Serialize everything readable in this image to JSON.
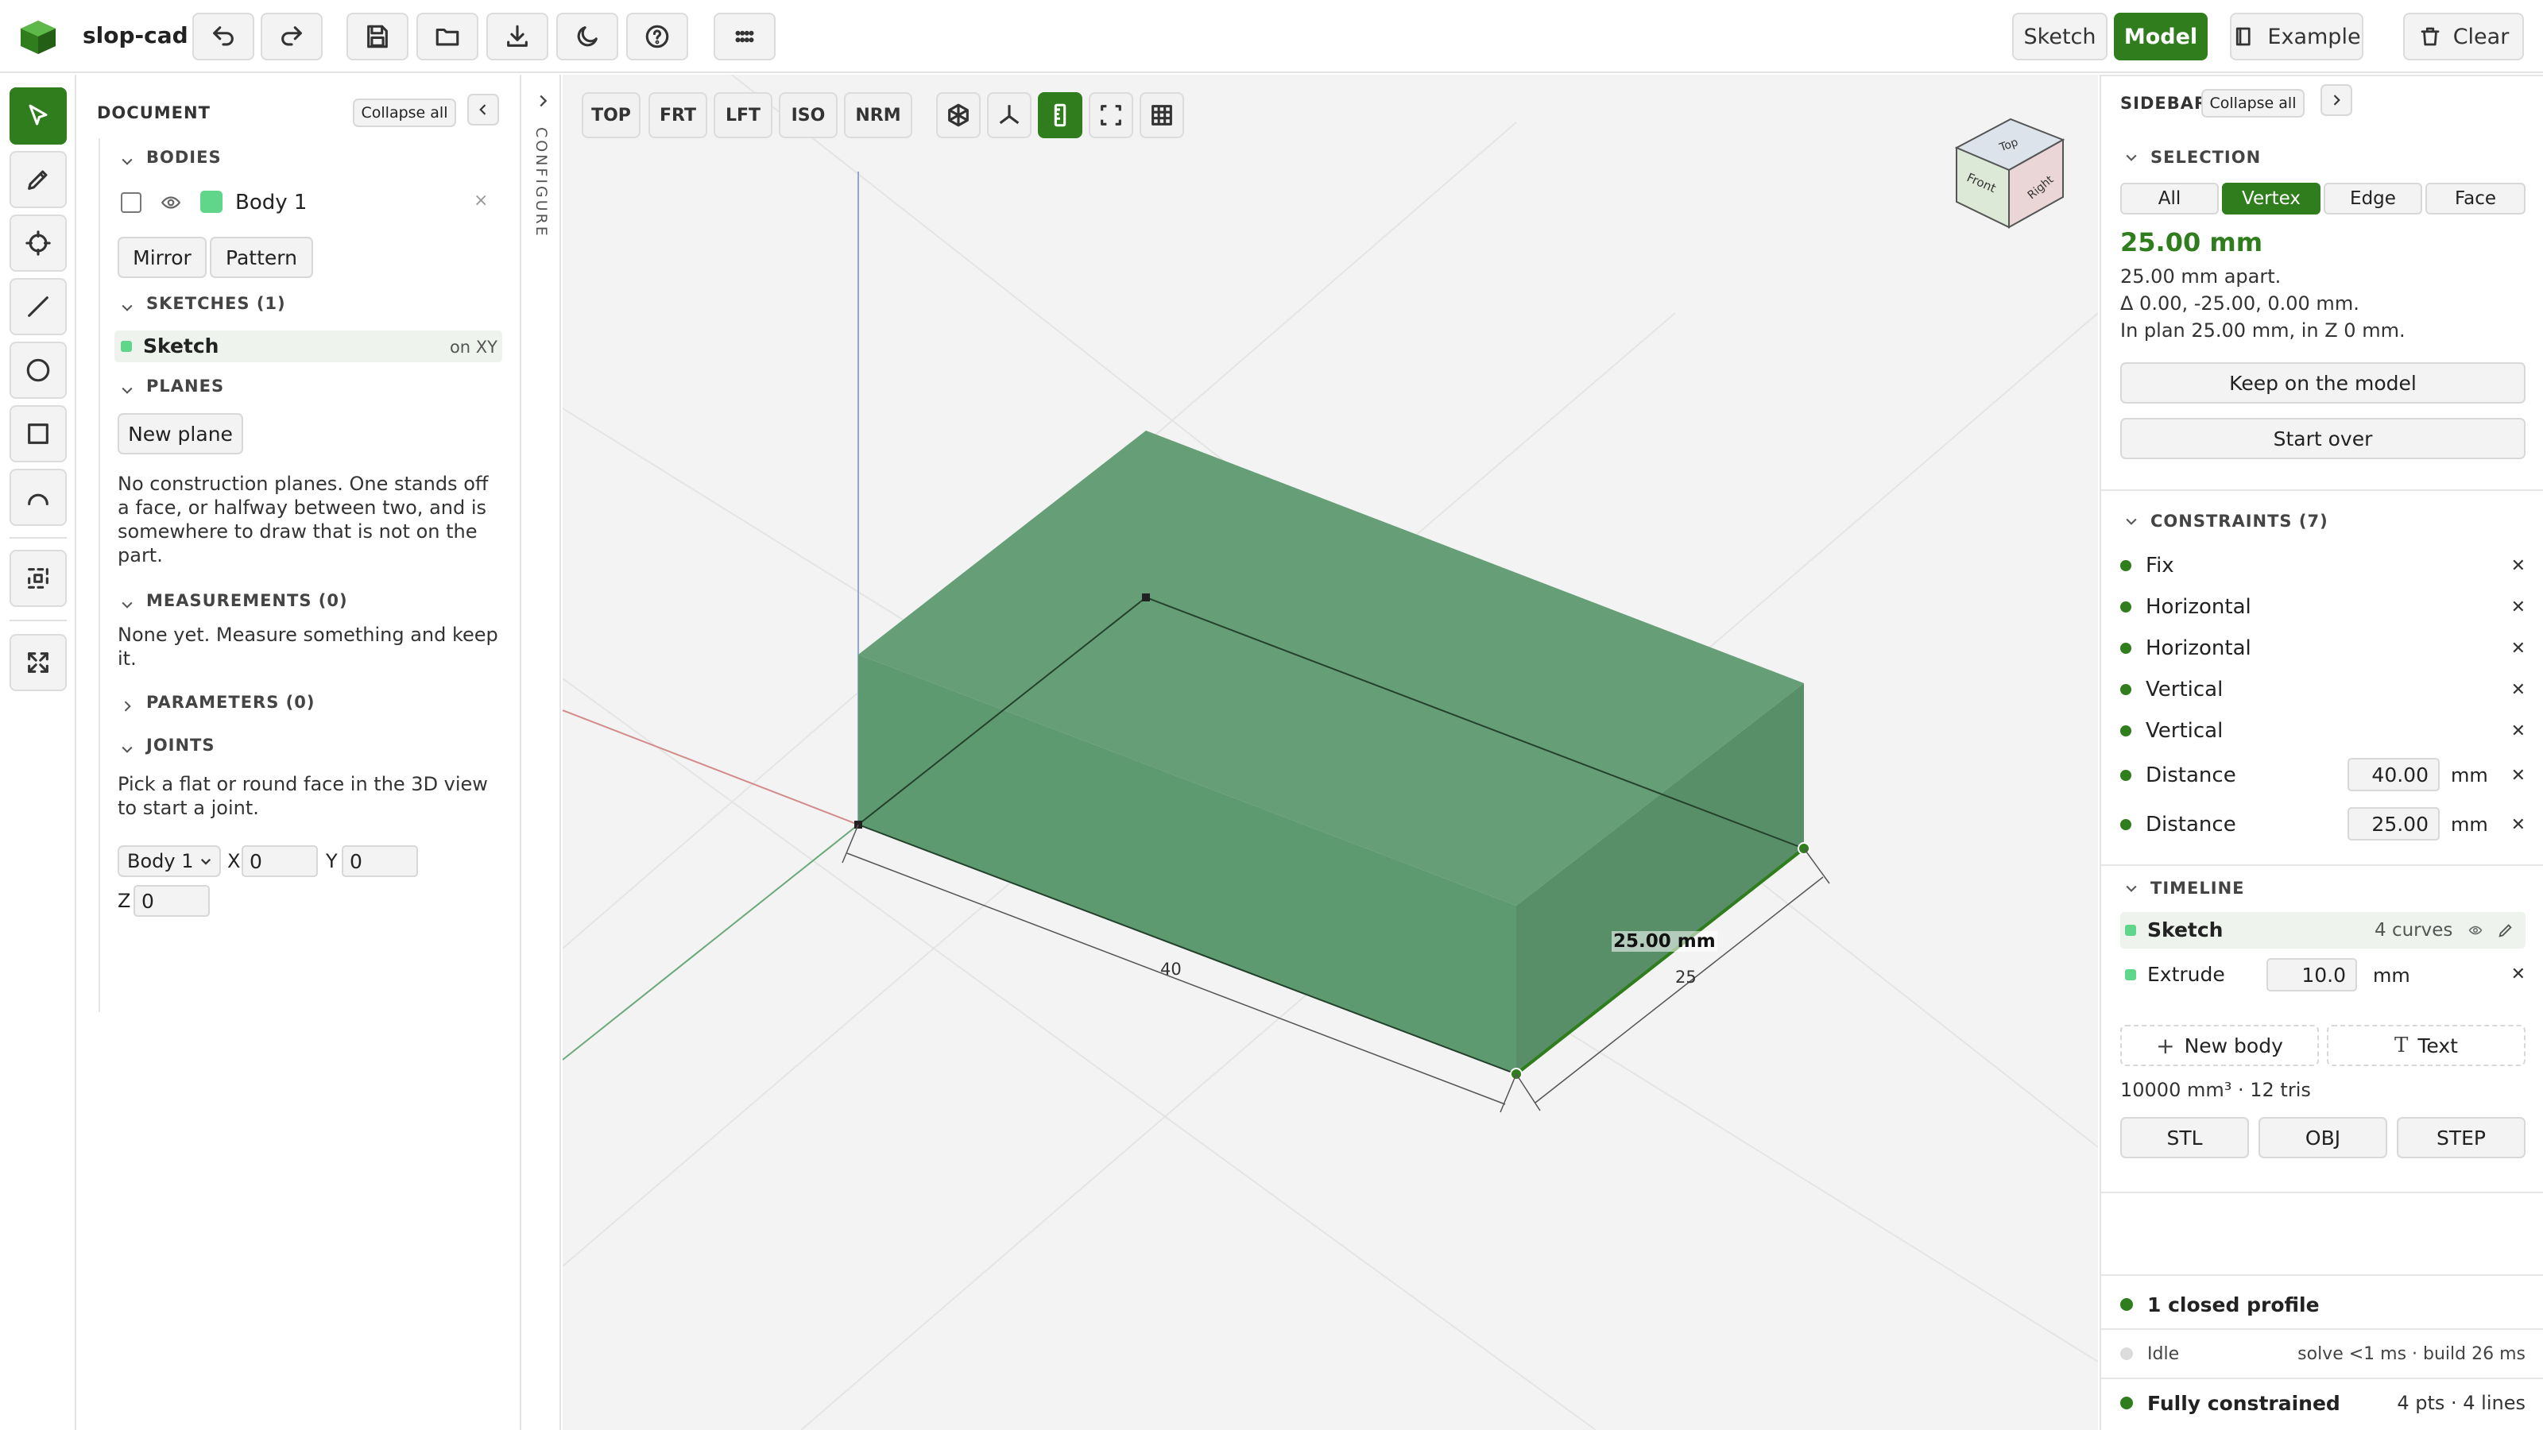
{
  "app": {
    "name": "slop-cad"
  },
  "topbar": {
    "mode_sketch": "Sketch",
    "mode_model": "Model",
    "example_label": "Example",
    "clear_label": "Clear",
    "icons": [
      "undo-icon",
      "redo-icon",
      "save-icon",
      "folder-open-icon",
      "download-icon",
      "moon-icon",
      "help-icon",
      "grid-dots-icon"
    ]
  },
  "tools": [
    "select-tool",
    "pencil-tool",
    "point-tool",
    "line-tool",
    "circle-tool",
    "rectangle-tool",
    "arc-tool",
    "crop-tool",
    "fit-view-tool"
  ],
  "document": {
    "title": "DOCUMENT",
    "collapse_all": "Collapse all",
    "bodies_header": "BODIES",
    "body1_name": "Body 1",
    "body1_color": "#5fd68a",
    "mirror_label": "Mirror",
    "pattern_label": "Pattern",
    "sketches_header": "SKETCHES (1)",
    "sketch_name": "Sketch",
    "sketch_plane": "on XY",
    "planes_header": "PLANES",
    "new_plane_label": "New plane",
    "planes_text": "No construction planes. One stands off a face, or halfway between two, and is somewhere to draw that is not on the part.",
    "measurements_header": "MEASUREMENTS (0)",
    "measurements_text": "None yet. Measure something and keep it.",
    "parameters_header": "PARAMETERS (0)",
    "joints_header": "JOINTS",
    "joints_text": "Pick a flat or round face in the 3D view to start a joint.",
    "joint_body_select": "Body 1",
    "joint_x_label": "X",
    "joint_x_value": "0",
    "joint_y_label": "Y",
    "joint_y_value": "0",
    "joint_z_label": "Z",
    "joint_z_value": "0"
  },
  "configure_label": "CONFIGURE",
  "viewport": {
    "view_buttons": [
      "TOP",
      "FRT",
      "LFT",
      "ISO",
      "NRM"
    ],
    "view_icons": [
      "cube-wire-icon",
      "axes-icon",
      "ruler-icon",
      "selection-box-icon",
      "grid-icon"
    ],
    "viewcube": {
      "top": "Top",
      "front": "Front",
      "right": "Right"
    },
    "dim_length": "40",
    "dim_width": "25",
    "measure_label": "25.00 mm",
    "body_color": "#5e9f70"
  },
  "sidebar": {
    "title": "SIDEBAR",
    "collapse_all": "Collapse all",
    "selection_header": "SELECTION",
    "selection_modes": [
      "All",
      "Vertex",
      "Edge",
      "Face"
    ],
    "selection_active": "Vertex",
    "measure_value": "25.00 mm",
    "measure_line1": "25.00 mm apart.",
    "measure_line2": "Δ 0.00, -25.00, 0.00 mm.",
    "measure_line3": "In plan 25.00 mm, in Z 0 mm.",
    "keep_label": "Keep on the model",
    "start_over_label": "Start over",
    "constraints_header": "CONSTRAINTS (7)",
    "constraints": [
      {
        "name": "Fix"
      },
      {
        "name": "Horizontal"
      },
      {
        "name": "Horizontal"
      },
      {
        "name": "Vertical"
      },
      {
        "name": "Vertical"
      },
      {
        "name": "Distance",
        "value": "40.00",
        "unit": "mm"
      },
      {
        "name": "Distance",
        "value": "25.00",
        "unit": "mm"
      }
    ],
    "timeline_header": "TIMELINE",
    "timeline_sketch": "Sketch",
    "timeline_sketch_info": "4 curves",
    "timeline_extrude": "Extrude",
    "timeline_extrude_value": "10.0",
    "timeline_extrude_unit": "mm",
    "new_body_label": "New body",
    "text_label": "Text",
    "stats": "10000 mm³ · 12 tris",
    "export_stl": "STL",
    "export_obj": "OBJ",
    "export_step": "STEP",
    "status_profile": "1 closed profile",
    "status_idle": "Idle",
    "status_timing": "solve <1 ms · build 26 ms",
    "status_constrained": "Fully constrained",
    "status_counts": "4 pts · 4 lines",
    "accent_color": "#2f7d1c"
  }
}
